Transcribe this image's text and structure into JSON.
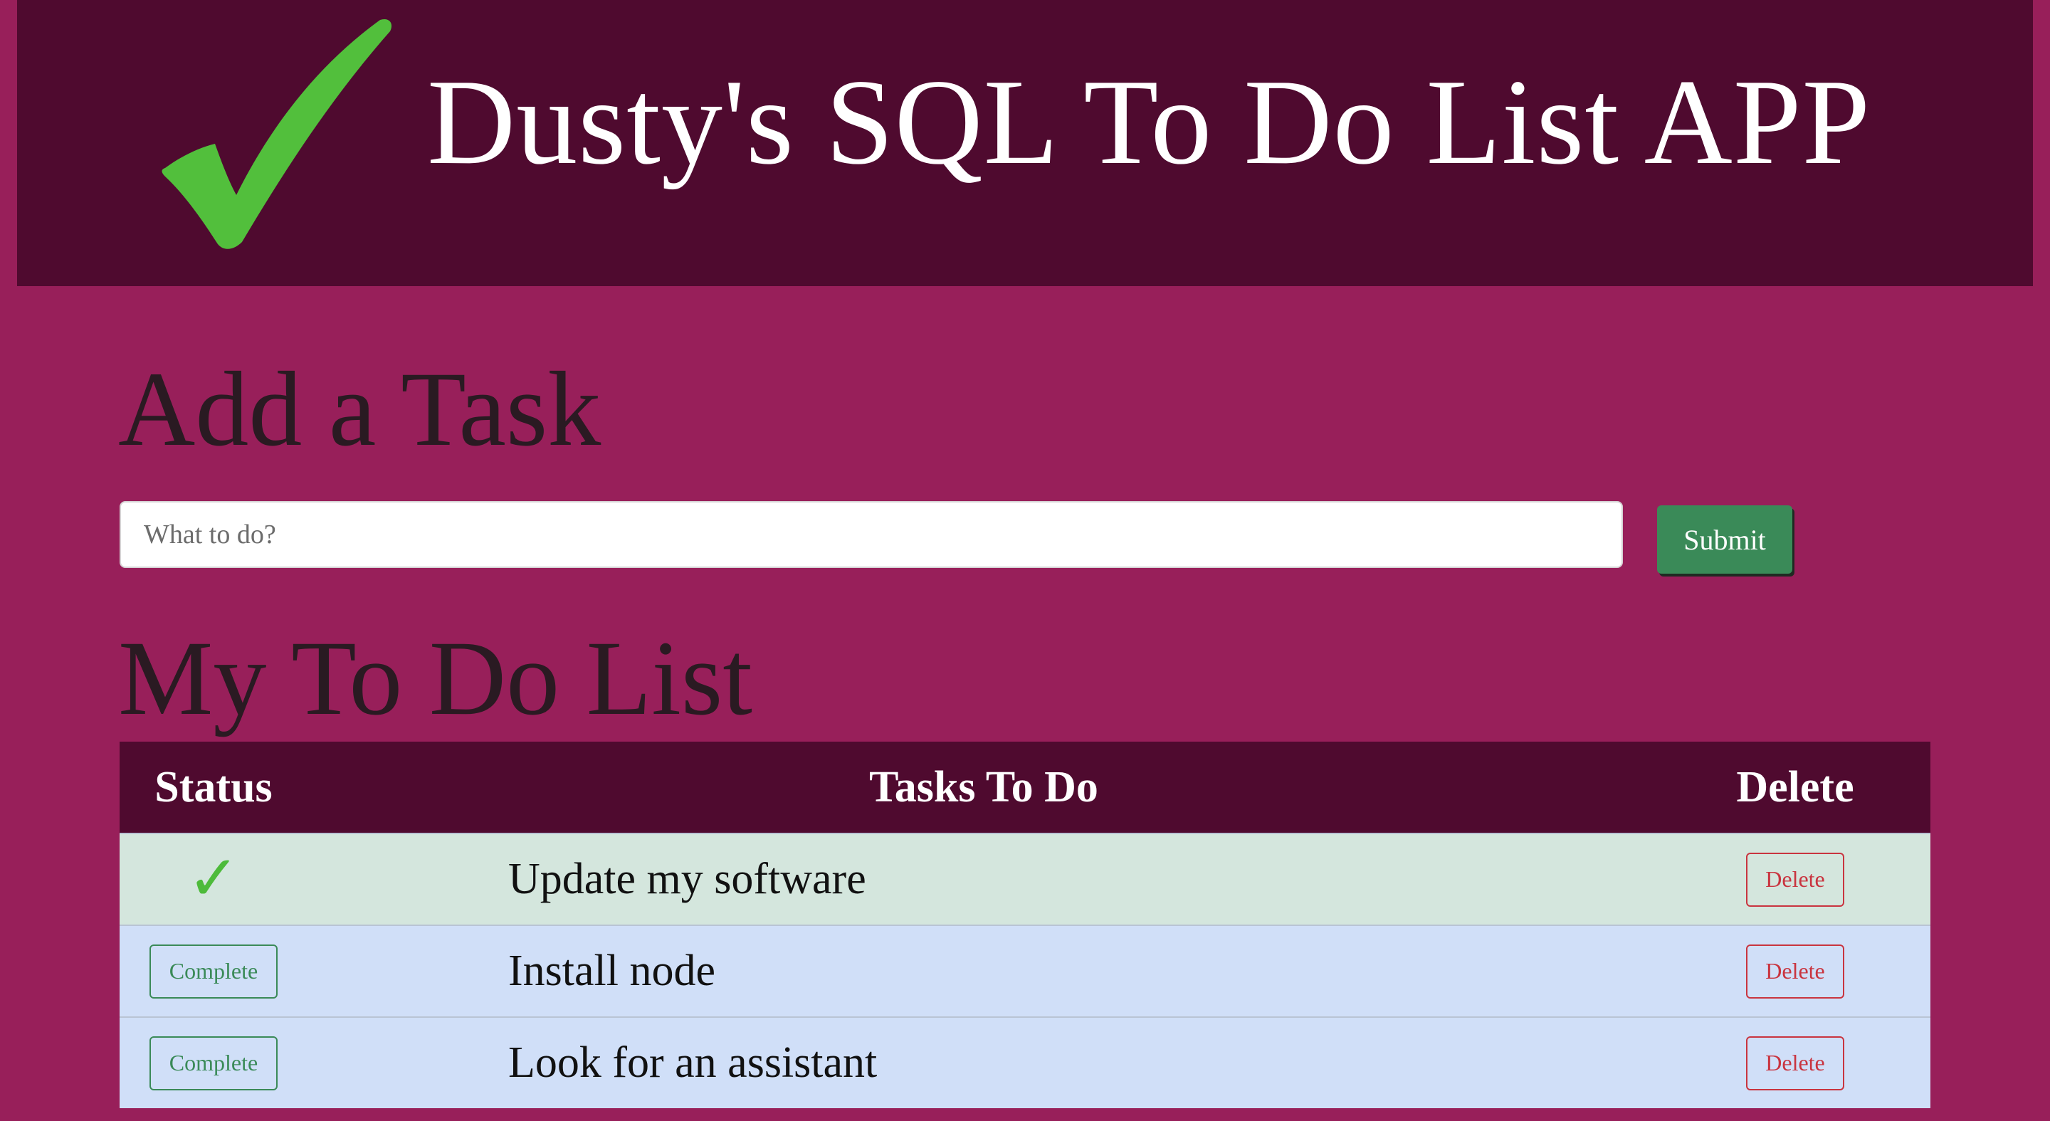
{
  "header": {
    "logo_icon": "checkmark-icon",
    "title": "Dusty's SQL To Do List APP",
    "colors": {
      "background": "#4f0a2f",
      "logo": "#52bf3c"
    }
  },
  "add_section": {
    "title": "Add a Task",
    "input_placeholder": "What to do?",
    "input_value": "",
    "submit_label": "Submit"
  },
  "list_section": {
    "title": "My To Do List",
    "columns": [
      "Status",
      "Tasks To Do",
      "Delete"
    ],
    "rows": [
      {
        "status": "complete",
        "status_icon": "checkmark-icon",
        "status_glyph": "✓",
        "task": "Update my software",
        "delete_label": "Delete"
      },
      {
        "status": "pending",
        "complete_label": "Complete",
        "task": "Install node",
        "delete_label": "Delete"
      },
      {
        "status": "pending",
        "complete_label": "Complete",
        "task": "Look for an assistant",
        "delete_label": "Delete"
      }
    ]
  },
  "colors": {
    "page_background": "#981f5a",
    "header_background": "#4f0a2f",
    "submit_green": "#3a8a58",
    "complete_row": "#d4e6dd",
    "pending_row": "#d0dff8",
    "delete_red": "#c9343f"
  }
}
